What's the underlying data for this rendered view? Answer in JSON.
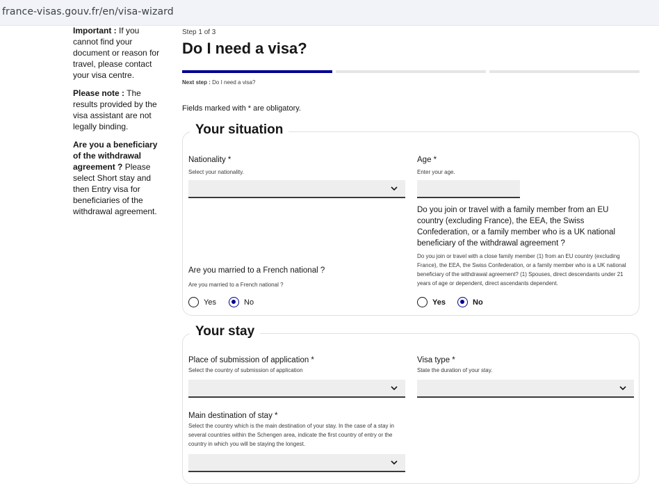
{
  "browser": {
    "url": "france-visas.gouv.fr/en/visa-wizard"
  },
  "sidebar": {
    "important_title": "Important :",
    "important_text": " If you cannot find your document or reason for travel, please contact your visa centre.",
    "note_title": "Please note :",
    "note_text": " The results provided by the visa assistant are not legally binding.",
    "beneficiary_title": "Are you a beneficiary of the withdrawal agreement ?",
    "beneficiary_text": " Please select Short stay and then Entry visa for beneficiaries of the withdrawal agreement."
  },
  "header": {
    "step": "Step 1 of 3",
    "title": "Do I need a visa?",
    "progress": {
      "current_step": 1,
      "total_steps": 3
    },
    "next_step_label": "Next step :",
    "next_step_value": " Do I need a visa?",
    "obligatory_note": "Fields marked with * are obligatory."
  },
  "situation": {
    "title": "Your situation",
    "nationality": {
      "label": "Nationality *",
      "hint": "Select your nationality.",
      "value": ""
    },
    "age": {
      "label": "Age *",
      "hint": "Enter your age.",
      "value": ""
    },
    "married": {
      "question": "Are you married to a French national ?",
      "hint": "Are you married to a French national ?",
      "yes": "Yes",
      "no": "No",
      "selected": "No"
    },
    "family": {
      "question": "Do you join or travel with a family member from an EU country (excluding France), the EEA, the Swiss Confederation, or a family member who is a UK national beneficiary of the withdrawal agreement ?",
      "hint": "Do you join or travel with a close family member (1) from an EU country (excluding France), the EEA, the Swiss Confederation, or a family member who is a UK national beneficiary of the withdrawal agreement? (1) Spouses, direct descendants under 21 years of age or dependent, direct ascendants dependent.",
      "yes": "Yes",
      "no": "No",
      "selected": "No"
    }
  },
  "stay": {
    "title": "Your stay",
    "submission": {
      "label": "Place of submission of application *",
      "hint": "Select the country of submission of application",
      "value": ""
    },
    "visa_type": {
      "label": "Visa type *",
      "hint": "State the duration of your stay.",
      "value": ""
    },
    "destination": {
      "label": "Main destination of stay *",
      "hint": "Select the country which is the main destination of your stay. In the case of a stay in several countries within the Schengen area, indicate the first country of entry or the country in which you will be staying the longest.",
      "value": ""
    }
  },
  "colors": {
    "primary": "#000091",
    "field_bg": "#eeeeee",
    "border": "#e0e0e0"
  }
}
